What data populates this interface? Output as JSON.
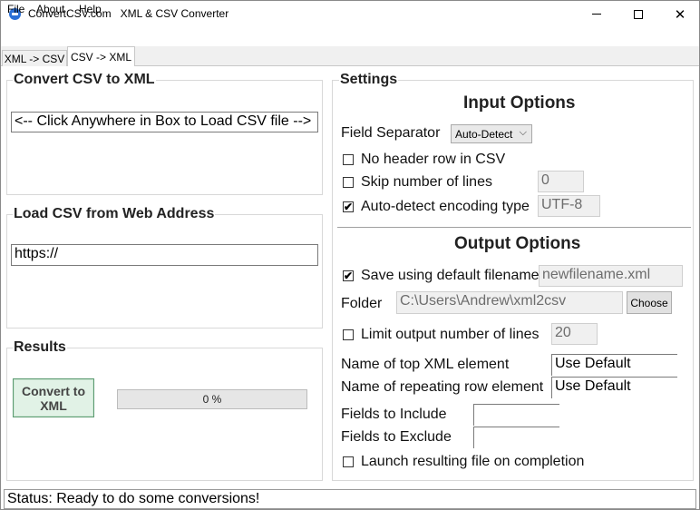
{
  "window": {
    "title": "ConvertCSV.com   XML & CSV Converter",
    "controls": {
      "minimize": "",
      "maximize": "",
      "close": "✕"
    }
  },
  "menu": {
    "file": "File",
    "about": "About",
    "help": "Help"
  },
  "tabs": [
    {
      "label": "XML -> CSV",
      "active": false
    },
    {
      "label": "CSV -> XML",
      "active": true
    }
  ],
  "convert_group": {
    "title": "Convert CSV to XML",
    "load_box_text": "<-- Click Anywhere in Box to Load CSV file -->"
  },
  "web_group": {
    "title": "Load CSV from Web Address",
    "url_value": "https://"
  },
  "results_group": {
    "title": "Results",
    "convert_button": "Convert to XML",
    "progress_text": "0 %",
    "progress_fraction": 0
  },
  "settings": {
    "title": "Settings",
    "input_options": {
      "heading": "Input Options",
      "field_separator_label": "Field Separator",
      "field_separator_value": "Auto-Detect",
      "no_header": {
        "label": "No header row in CSV",
        "checked": false
      },
      "skip_lines": {
        "label": "Skip number of lines",
        "checked": false,
        "value": "0"
      },
      "auto_encoding": {
        "label": "Auto-detect encoding type",
        "checked": true,
        "value": "UTF-8"
      }
    },
    "output_options": {
      "heading": "Output Options",
      "save_default": {
        "label": "Save using default filename",
        "checked": true,
        "value": "newfilename.xml"
      },
      "folder_label": "Folder",
      "folder_value": "C:\\Users\\Andrew\\xml2csv",
      "choose_button": "Choose",
      "limit_lines": {
        "label": "Limit output number of lines",
        "checked": false,
        "value": "20"
      },
      "top_xml_label": "Name of top XML element",
      "top_xml_value": "Use Default",
      "repeat_row_label": "Name of repeating row element",
      "repeat_row_value": "Use Default",
      "fields_include_label": "Fields to Include",
      "fields_include_value": "",
      "fields_exclude_label": "Fields to Exclude",
      "fields_exclude_value": "",
      "launch": {
        "label": "Launch resulting file on completion",
        "checked": false
      }
    }
  },
  "status": "Status: Ready to do some conversions!",
  "icons": {
    "check_mark": "✔",
    "dropdown_chevron": "⌵"
  }
}
